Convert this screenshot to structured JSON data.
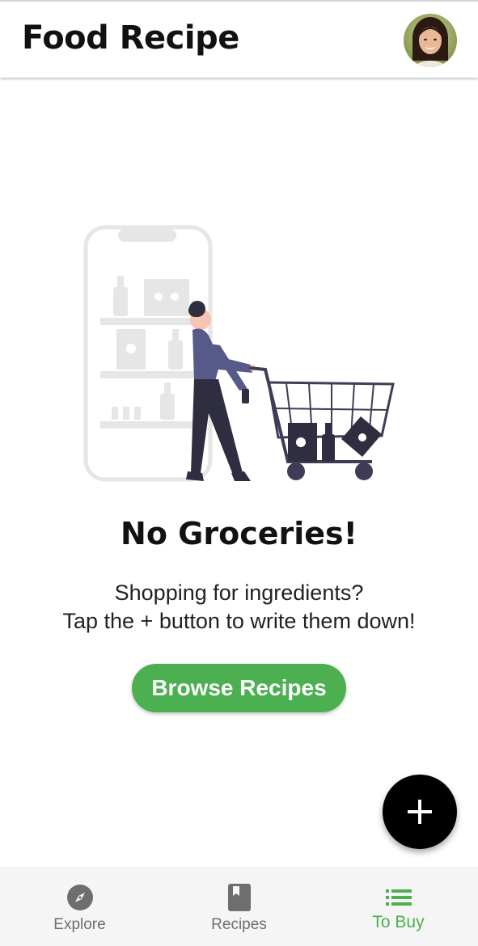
{
  "header": {
    "title": "Food Recipe"
  },
  "empty_state": {
    "title": "No Groceries!",
    "message_line1": "Shopping for ingredients?",
    "message_line2": "Tap the + button to write them down!",
    "browse_label": "Browse Recipes"
  },
  "fab": {
    "icon": "plus-icon"
  },
  "bottom_nav": {
    "items": [
      {
        "label": "Explore",
        "icon": "compass-icon",
        "active": false
      },
      {
        "label": "Recipes",
        "icon": "bookmark-book-icon",
        "active": false
      },
      {
        "label": "To Buy",
        "icon": "list-icon",
        "active": true
      }
    ]
  },
  "colors": {
    "accent": "#4caf50",
    "fab": "#000000",
    "inactive_nav": "#6e6e6e"
  }
}
